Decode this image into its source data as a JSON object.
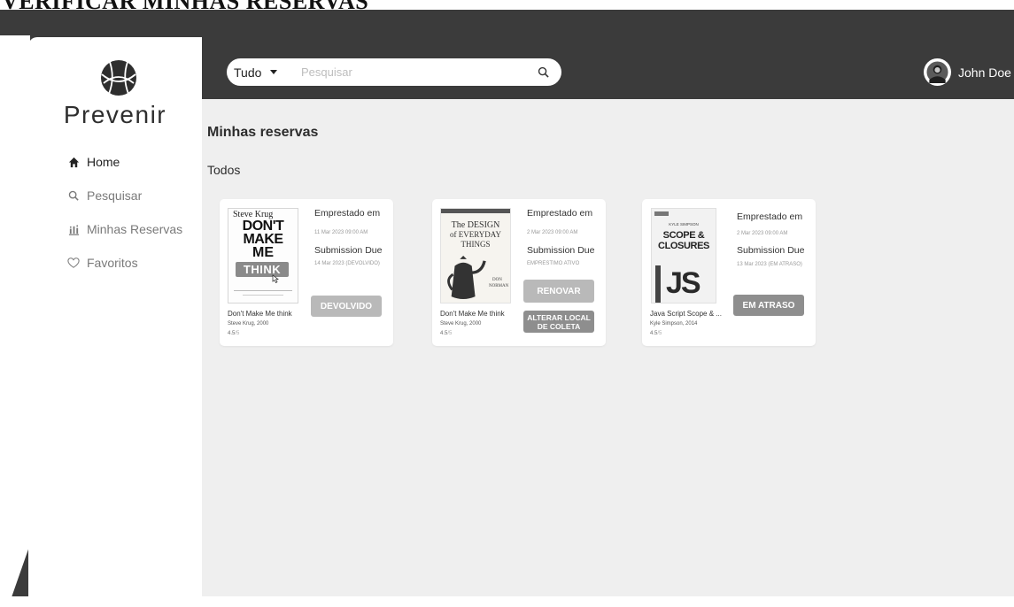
{
  "banner": {
    "title": "VERIFICAR MINHAS RESERVAS"
  },
  "brand": {
    "name": "Prevenir"
  },
  "sidebar": {
    "items": [
      {
        "label": "Home",
        "icon": "home-icon",
        "active": true
      },
      {
        "label": "Pesquisar",
        "icon": "search-icon"
      },
      {
        "label": "Minhas Reservas",
        "icon": "chart-icon"
      },
      {
        "label": "Favoritos",
        "icon": "heart-icon"
      }
    ]
  },
  "search": {
    "filter": "Tudo",
    "placeholder": "Pesquisar",
    "value": ""
  },
  "user": {
    "name": "John Doe"
  },
  "page": {
    "title": "Minhas reservas",
    "section": "Todos"
  },
  "reservations": [
    {
      "cover": {
        "line1": "Steve Krug",
        "line2": "DON'T",
        "line3": "MAKE",
        "line4": "ME",
        "line5": "THINK"
      },
      "title": "Don't Make Me think",
      "author": "Steve Krug, 2000",
      "rating": "4.5",
      "rating_max": "/5",
      "loan_label": "Emprestado em",
      "loan_date": "11 Mar 2023 09:00 AM",
      "due_label": "Submission Due",
      "due_date": "14 Mar 2023 (DEVOLVIDO)",
      "button": "DEVOLVIDO"
    },
    {
      "cover": {
        "line1": "The DESIGN",
        "line2": "of EVERYDAY",
        "line3": "THINGS",
        "line4": "DON",
        "line5": "NORMAN"
      },
      "title": "Don't Make Me think",
      "author": "Steve Krug, 2000",
      "rating": "4.5",
      "rating_max": "/5",
      "loan_label": "Emprestado em",
      "loan_date": "2 Mar 2023 09:00 AM",
      "due_label": "Submission Due",
      "due_date": "EMPRESTIMO ATIVO",
      "button": "RENOVAR",
      "button2": "ALTERAR LOCAL DE COLETA"
    },
    {
      "cover": {
        "line1": "KYLE SIMPSON",
        "line2": "SCOPE &",
        "line3": "CLOSURES",
        "line4": "JS"
      },
      "title": "Java Script Scope & ...",
      "author": "Kyle Simpson, 2014",
      "rating": "4.5",
      "rating_max": "/5",
      "loan_label": "Emprestado em",
      "loan_date": "2 Mar 2023 09:00 AM",
      "due_label": "Submission Due",
      "due_date": "13 Mar 2023 (EM ATRASO)",
      "button": "EM ATRASO"
    }
  ]
}
